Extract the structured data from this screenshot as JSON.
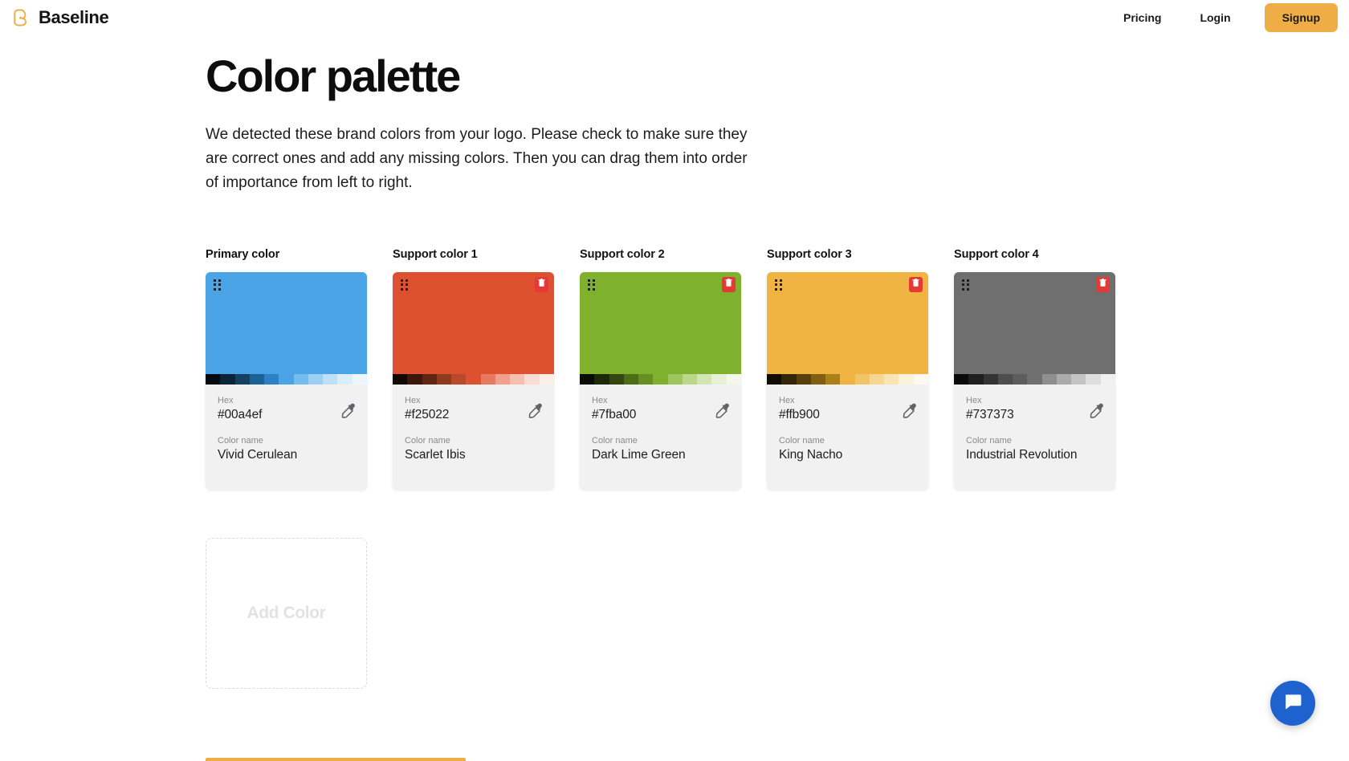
{
  "header": {
    "brand_name": "Baseline",
    "brand_icon": "baseline-logo-icon",
    "nav": [
      {
        "label": "Pricing",
        "name": "pricing"
      },
      {
        "label": "Login",
        "name": "login"
      }
    ],
    "signup_label": "Signup",
    "accent_color": "#efae45"
  },
  "main": {
    "title": "Color palette",
    "description": "We detected these brand colors from your logo. Please check to make sure they are correct ones and add any missing colors. Then you can drag them into order of importance from left to right.",
    "hex_label": "Hex",
    "color_name_label": "Color name",
    "add_color_label": "Add Color",
    "drag_handle_icon": "drag-handle-icon",
    "delete_icon": "trash-icon",
    "eyedropper_icon": "eyedropper-icon",
    "colors": [
      {
        "slot_label": "Primary color",
        "hex": "#00a4ef",
        "name": "Vivid Cerulean",
        "swatch": "#4aa3e4",
        "deletable": false,
        "shades": [
          "#040a10",
          "#0d2438",
          "#14415f",
          "#1c6296",
          "#2e80c4",
          "#4aa3e4",
          "#74bcec",
          "#9bd0f2",
          "#bfe0f7",
          "#dcedfa",
          "#eef6fd"
        ]
      },
      {
        "slot_label": "Support color 1",
        "hex": "#f25022",
        "name": "Scarlet Ibis",
        "swatch": "#dd5130",
        "deletable": true,
        "shades": [
          "#140603",
          "#3a180c",
          "#5f2713",
          "#8e3a1c",
          "#b9492a",
          "#dd5130",
          "#e87a5f",
          "#f0a08d",
          "#f5c0b2",
          "#f9dcd4",
          "#fdeeea"
        ]
      },
      {
        "slot_label": "Support color 2",
        "hex": "#7fba00",
        "name": "Dark Lime Green",
        "swatch": "#7fb02e",
        "deletable": true,
        "shades": [
          "#080c02",
          "#1d2a08",
          "#33470e",
          "#4d6c16",
          "#678e20",
          "#7fb02e",
          "#9dc65c",
          "#bad78c",
          "#d2e5b2",
          "#e7f1d6",
          "#f4f8ec"
        ]
      },
      {
        "slot_label": "Support color 3",
        "hex": "#ffb900",
        "name": "King Nacho",
        "swatch": "#efb441",
        "deletable": true,
        "shades": [
          "#100c02",
          "#332607",
          "#56400c",
          "#805f12",
          "#ab8019",
          "#efb441",
          "#f2c468",
          "#f6d792",
          "#f9e4b6",
          "#fcf1d9",
          "#fefaef"
        ]
      },
      {
        "slot_label": "Support color 4",
        "hex": "#737373",
        "name": "Industrial Revolution",
        "swatch": "#6f6f6f",
        "deletable": true,
        "shades": [
          "#0a0a0a",
          "#1f1f1f",
          "#343434",
          "#4e4e4e",
          "#5d5d5d",
          "#6f6f6f",
          "#8f8f8f",
          "#ababab",
          "#c4c4c4",
          "#dedede",
          "#f0f0f0"
        ]
      }
    ]
  },
  "chat": {
    "icon": "chat-bubble-icon",
    "color": "#1e62d0"
  }
}
